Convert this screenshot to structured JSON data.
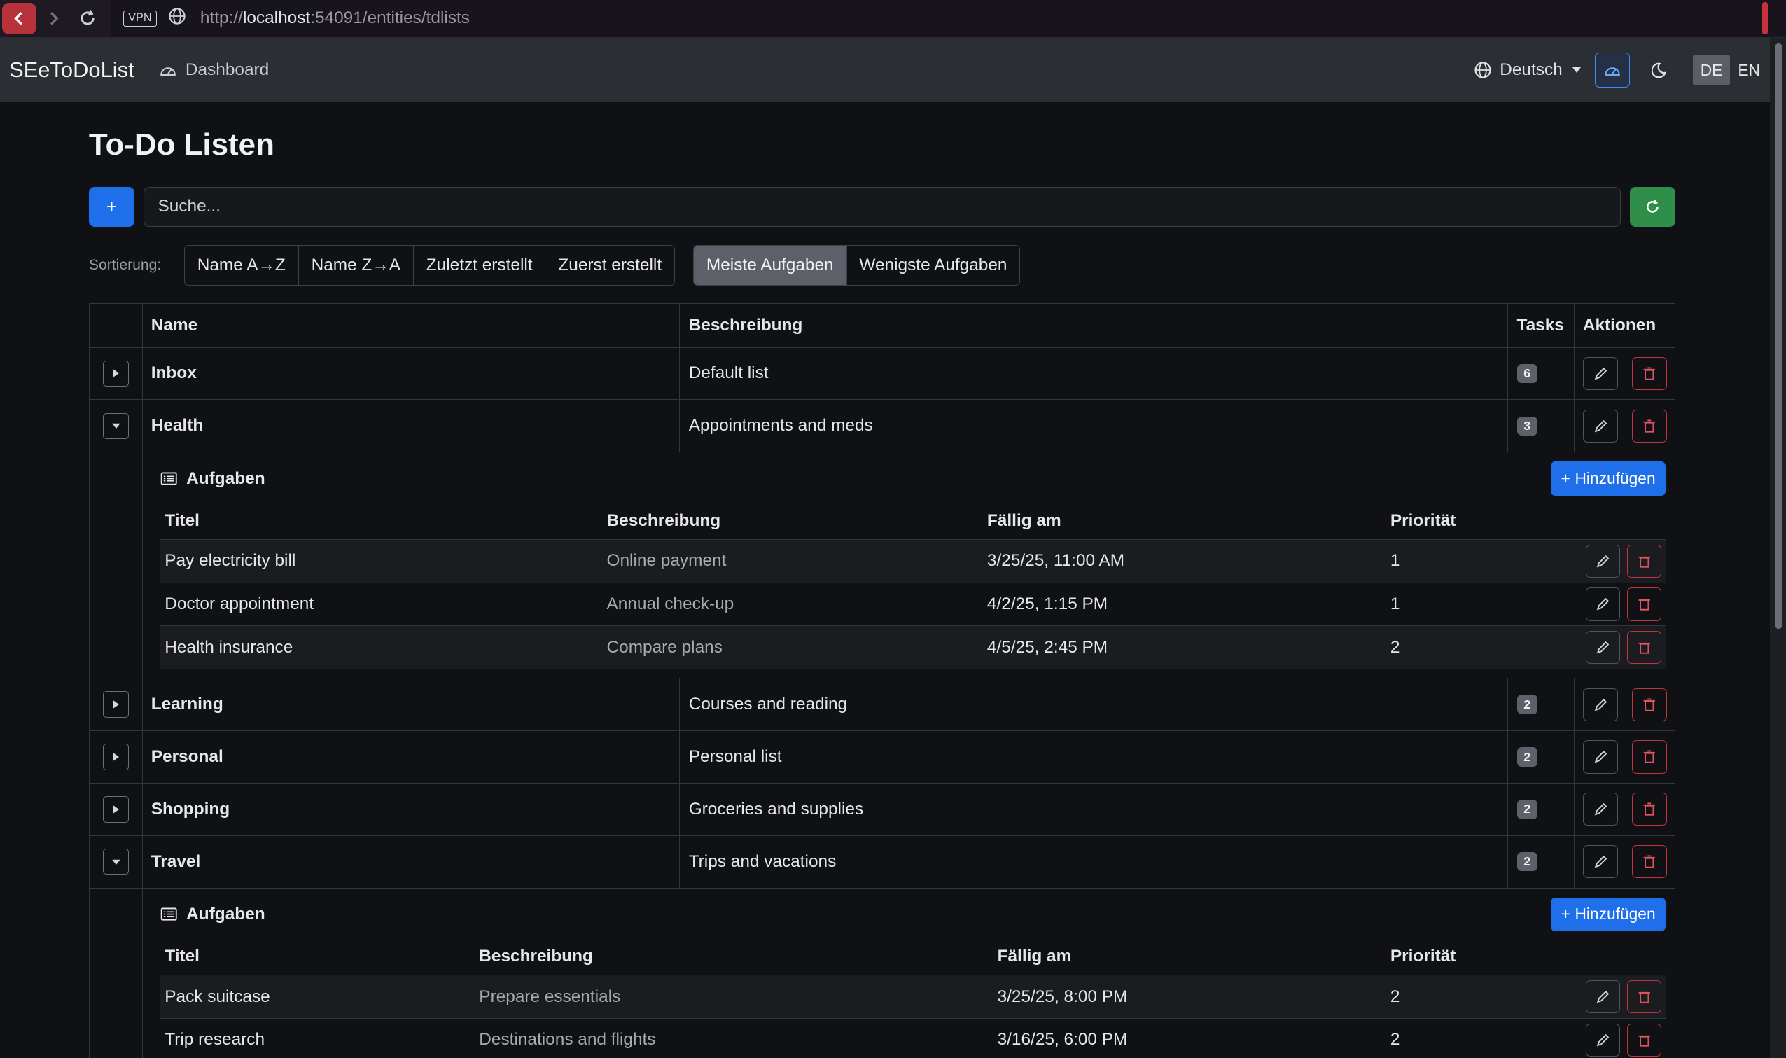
{
  "browser": {
    "url_prefix": "http://",
    "url_host": "localhost",
    "url_rest": ":54091/entities/tdlists",
    "vpn_label": "VPN"
  },
  "navbar": {
    "brand": "SEeToDoList",
    "dashboard_label": "Dashboard",
    "language_label": "Deutsch",
    "lang_de": "DE",
    "lang_en": "EN"
  },
  "page": {
    "title": "To-Do Listen",
    "add_label": "+",
    "search_placeholder": "Suche...",
    "sort_label": "Sortierung:",
    "sort_group1": [
      "Name A→Z",
      "Name Z→A",
      "Zuletzt erstellt",
      "Zuerst erstellt"
    ],
    "sort_group2": [
      "Meiste Aufgaben",
      "Wenigste Aufgaben"
    ],
    "active_sort": "Meiste Aufgaben"
  },
  "table": {
    "headers": {
      "name": "Name",
      "description": "Beschreibung",
      "tasks": "Tasks",
      "actions": "Aktionen"
    },
    "rows": [
      {
        "name": "Inbox",
        "description": "Default list",
        "tasks": "6",
        "expanded": false
      },
      {
        "name": "Health",
        "description": "Appointments and meds",
        "tasks": "3",
        "expanded": true
      },
      {
        "name": "Learning",
        "description": "Courses and reading",
        "tasks": "2",
        "expanded": false
      },
      {
        "name": "Personal",
        "description": "Personal list",
        "tasks": "2",
        "expanded": false
      },
      {
        "name": "Shopping",
        "description": "Groceries and supplies",
        "tasks": "2",
        "expanded": false
      },
      {
        "name": "Travel",
        "description": "Trips and vacations",
        "tasks": "2",
        "expanded": true
      }
    ]
  },
  "subtables": {
    "title": "Aufgaben",
    "add_label": "Hinzufügen",
    "headers": {
      "title": "Titel",
      "description": "Beschreibung",
      "due": "Fällig am",
      "priority": "Priorität"
    },
    "health": [
      {
        "title": "Pay electricity bill",
        "description": "Online payment",
        "due": "3/25/25, 11:00 AM",
        "priority": "1"
      },
      {
        "title": "Doctor appointment",
        "description": "Annual check-up",
        "due": "4/2/25, 1:15 PM",
        "priority": "1"
      },
      {
        "title": "Health insurance",
        "description": "Compare plans",
        "due": "4/5/25, 2:45 PM",
        "priority": "2"
      }
    ],
    "travel": [
      {
        "title": "Pack suitcase",
        "description": "Prepare essentials",
        "due": "3/25/25, 8:00 PM",
        "priority": "2"
      },
      {
        "title": "Trip research",
        "description": "Destinations and flights",
        "due": "3/16/25, 6:00 PM",
        "priority": "2"
      }
    ]
  },
  "colors": {
    "primary": "#1f6feb",
    "success": "#2f8f4a",
    "danger": "#c0353f",
    "background": "#101114",
    "navbar": "#2b2e33"
  }
}
